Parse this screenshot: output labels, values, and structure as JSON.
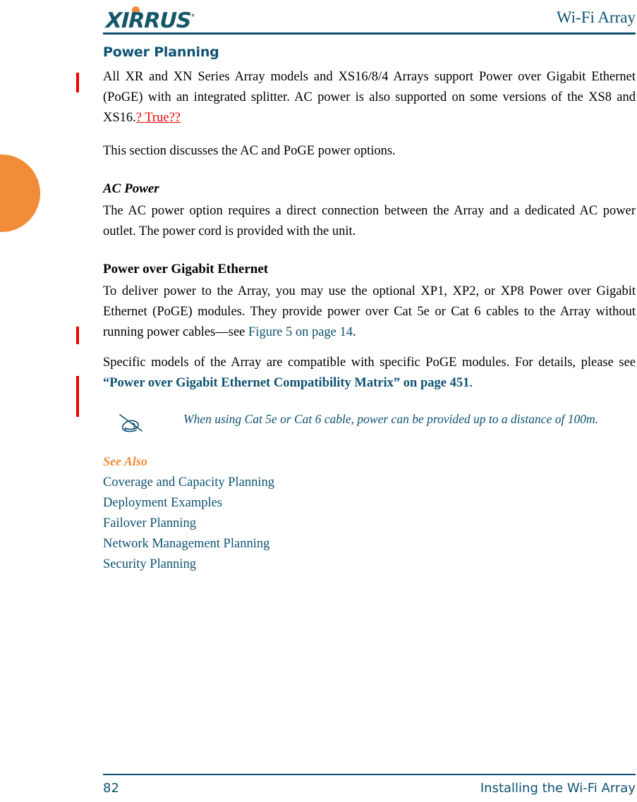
{
  "header": {
    "logo_text": "XIRRUS",
    "logo_trademark": "°",
    "title": "Wi-Fi Array"
  },
  "content": {
    "section_title": "Power Planning",
    "intro_paragraph": {
      "text": "All XR and XN Series Array models and XS16/8/4 Arrays support Power over Gigabit Ethernet (PoGE) with an integrated splitter. AC power is also supported on some versions of the XS8 and XS16.",
      "annotation": "? True?? "
    },
    "discuss_paragraph": "This section discusses the AC and PoGE power options.",
    "ac_power": {
      "heading": "AC Power",
      "paragraph": "The AC power option requires a direct connection between the Array and a dedicated AC power outlet. The power cord is provided with the unit."
    },
    "poge": {
      "heading": "Power over Gigabit Ethernet",
      "paragraph_1_before_link": "To deliver power to the Array, you may use the optional XP1, XP2, or XP8 Power over Gigabit Ethernet (PoGE) modules. They provide power over Cat 5e or Cat 6 cables to the Array without running power cables—see ",
      "paragraph_1_link": "Figure 5 on page 14",
      "paragraph_1_after_link": ".",
      "paragraph_2_before_link": "Specific models of the Array are compatible with specific PoGE modules. For details, please see ",
      "paragraph_2_link": "“Power over Gigabit Ethernet Compatibility Matrix” on page 451",
      "paragraph_2_after_link": "."
    },
    "note": {
      "icon": "pencil-note-icon",
      "text": "When using Cat 5e or Cat 6 cable, power can be provided up to a distance of 100m."
    },
    "see_also": {
      "heading": "See Also",
      "items": [
        "Coverage and Capacity Planning",
        "Deployment Examples",
        "Failover Planning",
        "Network Management Planning",
        "Security Planning"
      ]
    }
  },
  "footer": {
    "page_number": "82",
    "chapter": "Installing the Wi-Fi Array"
  },
  "colors": {
    "brand_teal": "#0d5272",
    "brand_orange": "#f28c38",
    "change_bar_red": "#ee0000",
    "annotation_red": "#ee0000"
  }
}
